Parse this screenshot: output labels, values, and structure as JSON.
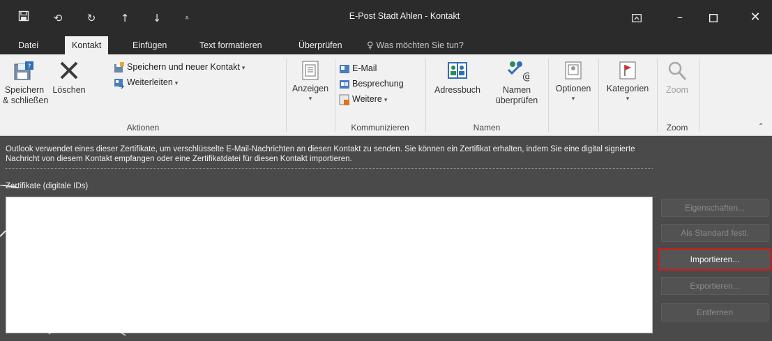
{
  "window": {
    "title": "E-Post Stadt Ahlen - Kontakt",
    "qat_icons": [
      "save-icon",
      "undo-icon",
      "redo-icon",
      "up-arrow-icon",
      "down-arrow-icon",
      "customize-qat-icon"
    ],
    "controls": {
      "ribbon_display": "ribbon-display-options-icon",
      "minimize": "minimize-icon",
      "maximize": "maximize-icon",
      "close": "close-icon"
    }
  },
  "tabs": [
    {
      "label": "Datei"
    },
    {
      "label": "Kontakt"
    },
    {
      "label": "Einfügen"
    },
    {
      "label": "Text formatieren"
    },
    {
      "label": "Überprüfen"
    }
  ],
  "tell_me": "Was möchten Sie tun?",
  "ribbon": {
    "aktionen": {
      "label": "Aktionen",
      "save_close": "Speichern\n& schließen",
      "delete": "Löschen",
      "save_new": "Speichern und neuer Kontakt",
      "forward": "Weiterleiten"
    },
    "anzeigen": {
      "label": "Anzeigen"
    },
    "kommunizieren": {
      "label": "Kommunizieren",
      "email": "E-Mail",
      "meeting": "Besprechung",
      "more": "Weitere"
    },
    "namen": {
      "label": "Namen",
      "address_book": "Adressbuch",
      "check_names": "Namen\nüberprüfen"
    },
    "optionen": {
      "label": "Optionen"
    },
    "kategorien": {
      "label": "Kategorien"
    },
    "zoom": {
      "label": "Zoom",
      "button": "Zoom"
    }
  },
  "content": {
    "info_text": "Outlook verwendet eines dieser Zertifikate, um verschlüsselte E-Mail-Nachrichten an diesen Kontakt zu senden. Sie können ein Zertifikat erhalten, indem Sie eine digital signierte Nachricht von diesem Kontakt empfangen oder eine Zertifikatdatei für diesen Kontakt importieren.",
    "cert_label": "Zertifikate (digitale IDs)",
    "buttons": {
      "properties": "Eigenschaften...",
      "set_default": "Als Standard festl.",
      "import": "Importieren...",
      "export": "Exportieren...",
      "remove": "Entfernen"
    }
  },
  "colors": {
    "titlebar": "#2b2b2b",
    "ribbon": "#f1f1f1",
    "content_bg": "#4a4a4a",
    "highlight": "#d01a1a"
  }
}
